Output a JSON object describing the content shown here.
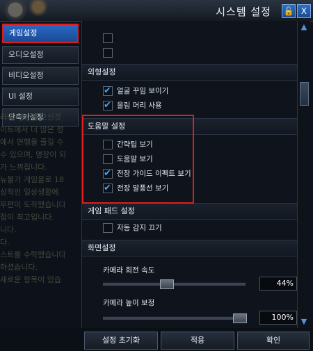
{
  "window": {
    "title": "시스템 설정"
  },
  "titlebar": {
    "lock_icon": "lock-icon",
    "close_icon": "close-icon",
    "close_glyph": "X"
  },
  "tabs": [
    {
      "label": "게임설정",
      "active": true
    },
    {
      "label": "오디오설정",
      "active": false
    },
    {
      "label": "비디오설정",
      "active": false
    },
    {
      "label": "UI 설정",
      "active": false
    },
    {
      "label": "단축키설정",
      "active": false
    }
  ],
  "background_text": [
    "라의 세상에 오신것",
    "이트에서 더 많은 정",
    "",
    "에서 연행을 즐길 수",
    "수 있으며, 명장이 되",
    "가 느껴집니다.",
    "뉴불가 게임을로 18",
    "상적인 일상생활에",
    "우편이 도착했습니다",
    "접이 최고입니다.",
    "",
    "니다.",
    "다.",
    "스트를 수락했습니다",
    "하셨습니다.",
    "새로운 항목이 있습"
  ],
  "sections": {
    "top_checkboxes": [
      {
        "label": "",
        "checked": false
      },
      {
        "label": "",
        "checked": false
      }
    ],
    "appearance": {
      "title": "외형설정",
      "items": [
        {
          "label": "얼굴 꾸밈 보이기",
          "checked": true
        },
        {
          "label": "올림 머리 사용",
          "checked": true
        }
      ]
    },
    "help": {
      "title": "도움말 설정",
      "items": [
        {
          "label": "간략팁 보기",
          "checked": false
        },
        {
          "label": "도움말 보기",
          "checked": false
        },
        {
          "label": "전장 가이드 이펙트 보기",
          "checked": true
        },
        {
          "label": "전장 말풍선 보기",
          "checked": true
        }
      ]
    },
    "gamepad": {
      "title": "게임 패드 설정",
      "items": [
        {
          "label": "자동 감지 끄기",
          "checked": false
        }
      ]
    },
    "screen": {
      "title": "화면설정",
      "sliders": [
        {
          "label": "카메라 회전 속도",
          "value_text": "44%",
          "value": 0.44
        },
        {
          "label": "카메라 높이 보정",
          "value_text": "100%",
          "value": 1.0
        }
      ]
    }
  },
  "buttons": {
    "reset": "설정 초기화",
    "apply": "적용",
    "confirm": "확인"
  },
  "colors": {
    "accent_blue": "#2a68c5",
    "highlight_red": "#e01c1c",
    "check_blue": "#39a8ff"
  }
}
